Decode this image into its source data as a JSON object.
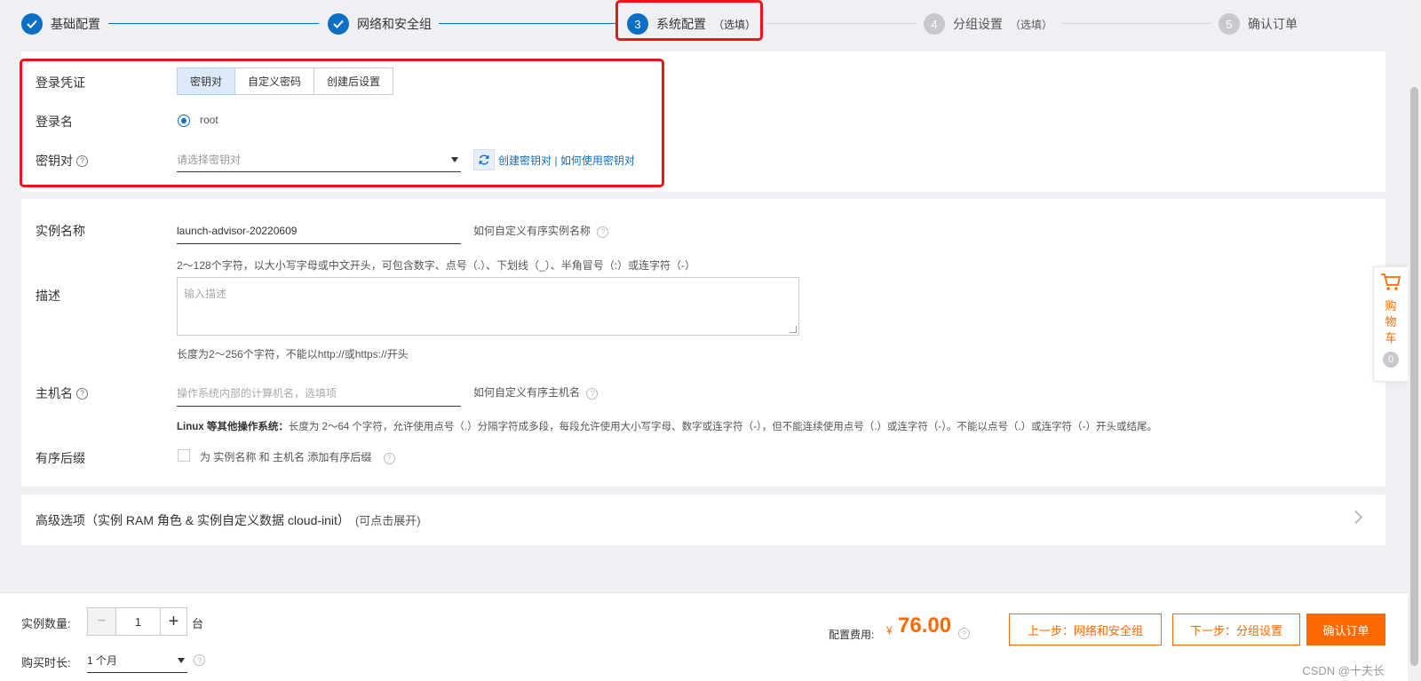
{
  "steps": [
    {
      "num": "1",
      "label": "基础配置",
      "optional": "",
      "state": "done"
    },
    {
      "num": "2",
      "label": "网络和安全组",
      "optional": "",
      "state": "done"
    },
    {
      "num": "3",
      "label": "系统配置",
      "optional": "（选填）",
      "state": "active"
    },
    {
      "num": "4",
      "label": "分组设置",
      "optional": "（选填）",
      "state": "todo"
    },
    {
      "num": "5",
      "label": "确认订单",
      "optional": "",
      "state": "todo"
    }
  ],
  "login": {
    "credential_label": "登录凭证",
    "credential_options": [
      "密钥对",
      "自定义密码",
      "创建后设置"
    ],
    "credential_selected": "密钥对",
    "username_label": "登录名",
    "username_value": "root",
    "keypair_label": "密钥对",
    "keypair_placeholder": "请选择密钥对",
    "create_keypair_link": "创建密钥对",
    "link_separator": " | ",
    "howto_keypair_link": "如何使用密钥对"
  },
  "instance": {
    "name_label": "实例名称",
    "name_value": "launch-advisor-20220609",
    "name_help": "如何自定义有序实例名称",
    "name_hint": "2～128个字符，以大小写字母或中文开头，可包含数字、点号（.）、下划线（_）、半角冒号（:）或连字符（-）",
    "desc_label": "描述",
    "desc_placeholder": "输入描述",
    "desc_hint": "长度为2～256个字符，不能以http://或https://开头",
    "host_label": "主机名",
    "host_placeholder": "操作系统内部的计算机名，选填项",
    "host_help": "如何自定义有序主机名",
    "host_hint_bold": "Linux 等其他操作系统：",
    "host_hint": "长度为 2～64 个字符，允许使用点号（.）分隔字符成多段，每段允许使用大小写字母、数字或连字符（-），但不能连续使用点号（.）或连字符（-）。不能以点号（.）或连字符（-）开头或结尾。",
    "suffix_label": "有序后缀",
    "suffix_text": "为 实例名称 和 主机名 添加有序后缀"
  },
  "advanced": {
    "title": "高级选项（实例 RAM 角色 & 实例自定义数据 cloud-init）",
    "subtitle": "(可点击展开)"
  },
  "footer": {
    "qty_label": "实例数量:",
    "qty_value": "1",
    "qty_unit": "台",
    "duration_label": "购买时长:",
    "duration_value": "1 个月",
    "price_label": "配置费用:",
    "currency": "¥",
    "price": "76.00",
    "prev_button": "上一步：网络和安全组",
    "next_button": "下一步：分组设置",
    "confirm_button": "确认订单",
    "watermark": "CSDN @十夫长"
  },
  "cart": {
    "label": "购物车",
    "count": "0"
  },
  "colors": {
    "primary": "#0b6fc6",
    "accent": "#ff6a00",
    "highlight": "#e8151b"
  }
}
